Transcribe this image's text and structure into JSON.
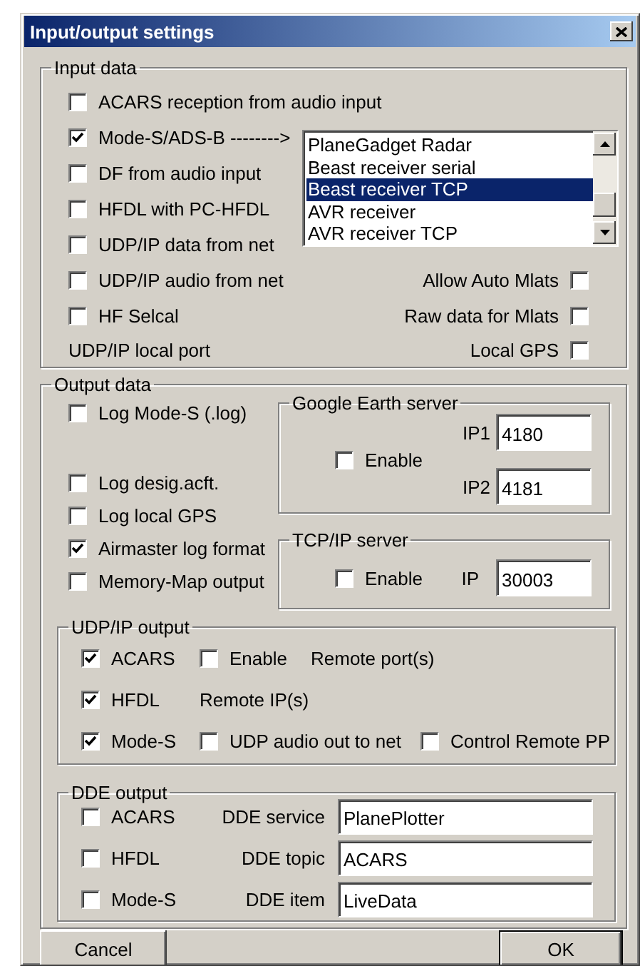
{
  "window": {
    "title": "Input/output settings"
  },
  "input_data": {
    "legend": "Input data",
    "options": [
      {
        "label": "ACARS reception from audio input",
        "checked": false
      },
      {
        "label": "Mode-S/ADS-B -------->",
        "checked": true
      },
      {
        "label": "DF from audio input",
        "checked": false
      },
      {
        "label": "HFDL with PC-HFDL",
        "checked": false
      },
      {
        "label": "UDP/IP data from net",
        "checked": false
      },
      {
        "label": "UDP/IP audio from net",
        "checked": false
      },
      {
        "label": "HF Selcal",
        "checked": false
      }
    ],
    "local_port_label": "UDP/IP local port",
    "receiver_list": [
      {
        "label": "PlaneGadget Radar",
        "selected": false
      },
      {
        "label": "Beast receiver serial",
        "selected": false
      },
      {
        "label": "Beast receiver TCP",
        "selected": true
      },
      {
        "label": "AVR receiver",
        "selected": false
      },
      {
        "label": "AVR receiver TCP",
        "selected": false
      }
    ],
    "mlat_options": [
      {
        "label": "Allow Auto Mlats",
        "checked": false
      },
      {
        "label": "Raw data for Mlats",
        "checked": false
      },
      {
        "label": "Local GPS",
        "checked": false
      }
    ]
  },
  "output_data": {
    "legend": "Output data",
    "options": [
      {
        "label": "Log Mode-S (.log)",
        "checked": false
      },
      {
        "label": "Log desig.acft.",
        "checked": false
      },
      {
        "label": "Log local GPS",
        "checked": false
      },
      {
        "label": "Airmaster log format",
        "checked": true
      },
      {
        "label": "Memory-Map output",
        "checked": false
      }
    ],
    "google_earth_server": {
      "legend": "Google Earth server",
      "enable": {
        "label": "Enable",
        "checked": false
      },
      "ports": [
        {
          "label": "IP1",
          "value": "4180"
        },
        {
          "label": "IP2",
          "value": "4181"
        }
      ]
    },
    "tcp_ip_server": {
      "legend": "TCP/IP server",
      "enable": {
        "label": "Enable",
        "checked": false
      },
      "port": {
        "label": "IP",
        "value": "30003"
      }
    },
    "udp_ip_output": {
      "legend": "UDP/IP output",
      "acars": {
        "label": "ACARS",
        "checked": true
      },
      "enable": {
        "label": "Enable",
        "checked": false
      },
      "remote_ports_label": "Remote port(s)",
      "hfdl": {
        "label": "HFDL",
        "checked": true
      },
      "remote_ips_label": "Remote IP(s)",
      "mode_s": {
        "label": "Mode-S",
        "checked": true
      },
      "udp_audio_out": {
        "label": "UDP audio out to net",
        "checked": false
      },
      "control_remote_pp": {
        "label": "Control Remote PP",
        "checked": false
      }
    },
    "dde_output": {
      "legend": "DDE output",
      "rows": [
        {
          "label": "ACARS",
          "checked": false,
          "field_label": "DDE service",
          "value": "PlanePlotter"
        },
        {
          "label": "HFDL",
          "checked": false,
          "field_label": "DDE topic",
          "value": "ACARS"
        },
        {
          "label": "Mode-S",
          "checked": false,
          "field_label": "DDE item",
          "value": "LiveData"
        }
      ]
    }
  },
  "buttons": [
    {
      "label": "Cancel",
      "default": false
    },
    {
      "label": "OK",
      "default": true
    }
  ]
}
